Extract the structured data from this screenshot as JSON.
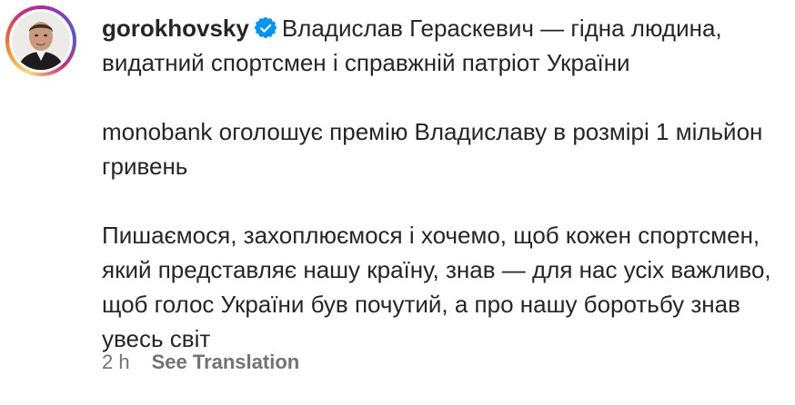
{
  "post": {
    "username": "gorokhovsky",
    "verified_icon": "verified-badge-icon",
    "avatar_icon": "profile-photo",
    "line1": "Владислав Гераскевич — гідна людина, видатний спортсмен і справжній патріот України",
    "paragraph2": "monobank оголошує премію Владиславу в розмірі 1 мільйон гривень",
    "paragraph3": "Пишаємося, захоплюємося і хочемо, щоб кожен спортсмен, який представляє нашу країну, знав — для нас усіх важливо, щоб голос України був почутий, а про нашу боротьбу знав увесь світ"
  },
  "meta": {
    "timestamp": "2 h",
    "see_translation_label": "See Translation"
  },
  "colors": {
    "text": "#262626",
    "secondary": "#737373",
    "verified": "#0095f6"
  }
}
